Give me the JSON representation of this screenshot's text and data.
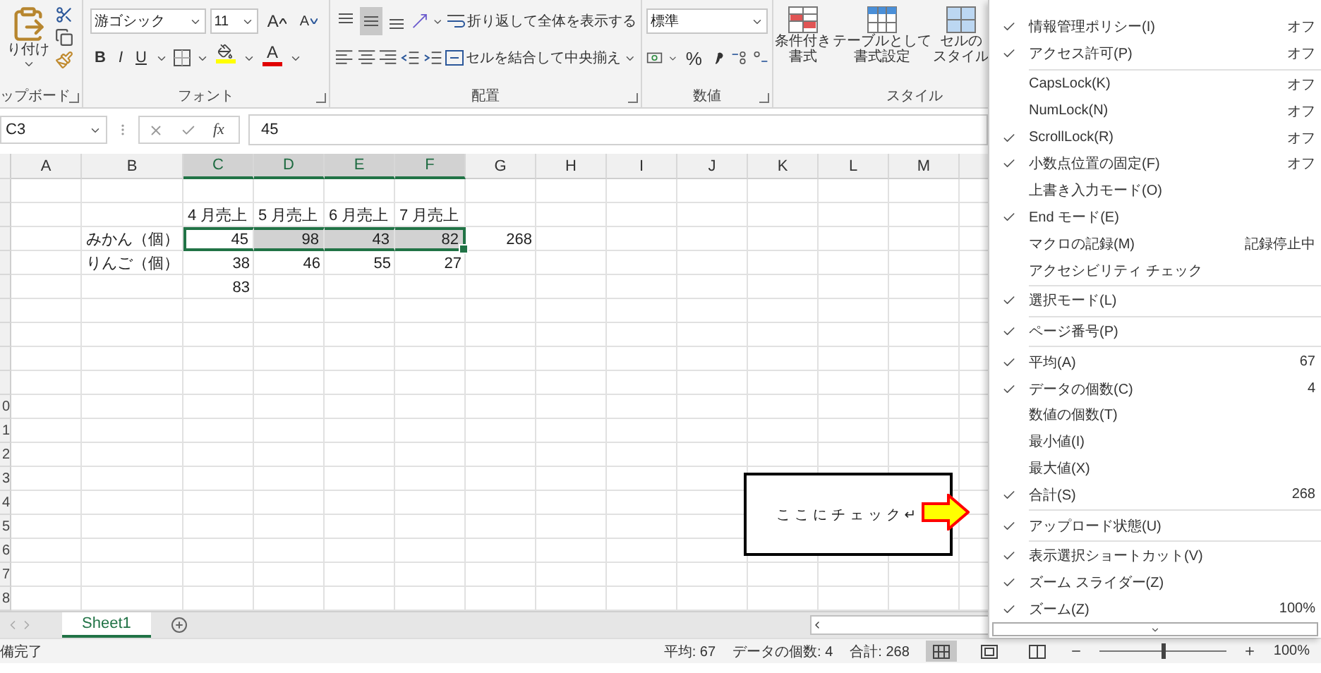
{
  "ribbon": {
    "clipboard": {
      "paste": "り付け",
      "label": "ップボード"
    },
    "font": {
      "font_name": "游ゴシック",
      "font_size": "11",
      "grow": "A",
      "shrink": "A",
      "bold": "B",
      "italic": "I",
      "underline": "U",
      "font_color": "A",
      "label": "フォント"
    },
    "alignment": {
      "vertical": [
        {
          "kind": "top",
          "selected": false
        },
        {
          "kind": "middle",
          "selected": true
        },
        {
          "kind": "bottom",
          "selected": false
        }
      ],
      "wrap_text": "折り返して全体を表示する",
      "merge_center": "セルを結合して中央揃え",
      "label": "配置"
    },
    "number": {
      "format": "標準",
      "percent": "%",
      "label": "数値"
    },
    "styles": {
      "buttons": [
        {
          "kind": "conditional",
          "lines": [
            "条件付き",
            "書式"
          ]
        },
        {
          "kind": "table",
          "lines": [
            "テーブルとして",
            "書式設定"
          ]
        },
        {
          "kind": "cell",
          "lines": [
            "セルの",
            "スタイル"
          ]
        }
      ],
      "label": "スタイル"
    }
  },
  "formula_bar": {
    "name_box": "C3",
    "fx": "fx",
    "value": "45"
  },
  "sheet": {
    "columns": [
      {
        "label": "A",
        "selected": false
      },
      {
        "label": "B",
        "selected": false
      },
      {
        "label": "C",
        "selected": true
      },
      {
        "label": "D",
        "selected": true
      },
      {
        "label": "E",
        "selected": true
      },
      {
        "label": "F",
        "selected": true
      },
      {
        "label": "G",
        "selected": false
      },
      {
        "label": "H",
        "selected": false
      },
      {
        "label": "I",
        "selected": false
      },
      {
        "label": "J",
        "selected": false
      },
      {
        "label": "K",
        "selected": false
      },
      {
        "label": "L",
        "selected": false
      },
      {
        "label": "M",
        "selected": false
      }
    ],
    "rows": [
      {},
      {
        "cells": [
          {
            "kind": "empty",
            "selected": false
          },
          {
            "kind": "empty",
            "selected": false
          },
          {
            "kind": "text",
            "text": "4 月売上",
            "selected": false
          },
          {
            "kind": "text",
            "text": "5 月売上",
            "selected": false
          },
          {
            "kind": "text",
            "text": "6 月売上",
            "selected": false
          },
          {
            "kind": "text",
            "text": "7 月売上",
            "selected": false
          },
          {
            "kind": "empty",
            "selected": false
          }
        ]
      },
      {
        "cells": [
          {
            "kind": "empty",
            "selected": false
          },
          {
            "kind": "text",
            "text": "みかん（個）",
            "selected": false
          },
          {
            "kind": "number",
            "text": "45",
            "selected": true
          },
          {
            "kind": "number",
            "text": "98",
            "selected": true
          },
          {
            "kind": "number",
            "text": "43",
            "selected": true
          },
          {
            "kind": "number",
            "text": "82",
            "selected": true
          },
          {
            "kind": "number",
            "text": "268",
            "selected": false
          }
        ]
      },
      {
        "cells": [
          {
            "kind": "empty",
            "selected": false
          },
          {
            "kind": "text",
            "text": "りんご（個）",
            "selected": false
          },
          {
            "kind": "number",
            "text": "38",
            "selected": false
          },
          {
            "kind": "number",
            "text": "46",
            "selected": false
          },
          {
            "kind": "number",
            "text": "55",
            "selected": false
          },
          {
            "kind": "number",
            "text": "27",
            "selected": false
          },
          {
            "kind": "empty",
            "selected": false
          }
        ]
      },
      {
        "cells": [
          {
            "kind": "empty",
            "selected": false
          },
          {
            "kind": "empty",
            "selected": false
          },
          {
            "kind": "number",
            "text": "83",
            "selected": false
          }
        ]
      },
      {},
      {},
      {},
      {},
      {
        "header": "0"
      },
      {
        "header": "1"
      },
      {
        "header": "2"
      },
      {
        "header": "3"
      },
      {
        "header": "4"
      },
      {
        "header": "5"
      },
      {
        "header": "6"
      },
      {
        "header": "7"
      },
      {
        "header": "8"
      }
    ],
    "callout": {
      "text": "ここにチェック↵"
    },
    "tabs": [
      {
        "label": "Sheet1",
        "selected": true
      }
    ]
  },
  "status_bar": {
    "ready": "備完了",
    "stats": [
      "平均: 67",
      "データの個数: 4",
      "合計: 268"
    ],
    "views": [
      {
        "kind": "normal",
        "selected": true
      },
      {
        "kind": "page_layout",
        "selected": false
      },
      {
        "kind": "page_break",
        "selected": false
      }
    ],
    "zoom_level": {
      "level": 0.5
    },
    "zoom": "100%"
  },
  "menu": {
    "groups": [
      {
        "items": [
          {
            "label": "情報管理ポリシー(I)",
            "checked": true,
            "value": "オフ"
          },
          {
            "label": "アクセス許可(P)",
            "checked": true,
            "value": "オフ"
          }
        ]
      },
      {
        "items": [
          {
            "label": "CapsLock(K)",
            "checked": false,
            "value": "オフ"
          },
          {
            "label": "NumLock(N)",
            "checked": false,
            "value": "オフ"
          },
          {
            "label": "ScrollLock(R)",
            "checked": true,
            "value": "オフ"
          },
          {
            "label": "小数点位置の固定(F)",
            "checked": true,
            "value": "オフ"
          },
          {
            "label": "上書き入力モード(O)",
            "checked": false
          },
          {
            "label": "End モード(E)",
            "checked": true
          },
          {
            "label": "マクロの記録(M)",
            "checked": false,
            "value": "記録停止中"
          },
          {
            "label": "アクセシビリティ チェック",
            "checked": false
          }
        ]
      },
      {
        "items": [
          {
            "label": "選択モード(L)",
            "checked": true
          }
        ]
      },
      {
        "items": [
          {
            "label": "ページ番号(P)",
            "checked": true
          }
        ]
      },
      {
        "items": [
          {
            "label": "平均(A)",
            "checked": true,
            "value": "67"
          },
          {
            "label": "データの個数(C)",
            "checked": true,
            "value": "4"
          },
          {
            "label": "数値の個数(T)",
            "checked": false
          },
          {
            "label": "最小値(I)",
            "checked": false
          },
          {
            "label": "最大値(X)",
            "checked": false
          },
          {
            "label": "合計(S)",
            "checked": true,
            "value": "268"
          }
        ]
      },
      {
        "items": [
          {
            "label": "アップロード状態(U)",
            "checked": true
          }
        ]
      },
      {
        "items": [
          {
            "label": "表示選択ショートカット(V)",
            "checked": true
          },
          {
            "label": "ズーム スライダー(Z)",
            "checked": true
          },
          {
            "label": "ズーム(Z)",
            "checked": true,
            "value": "100%"
          }
        ]
      }
    ]
  }
}
